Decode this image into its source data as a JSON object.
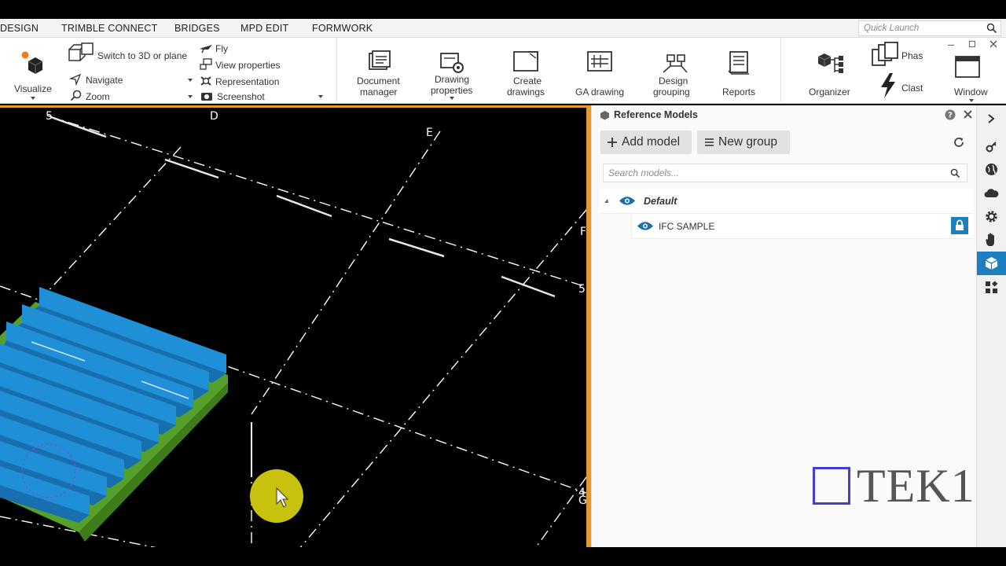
{
  "menu": {
    "tabs": [
      "DESIGN",
      "TRIMBLE CONNECT",
      "BRIDGES",
      "MPD EDIT",
      "FORMWORK"
    ],
    "quick_launch_placeholder": "Quick Launch"
  },
  "ribbon": {
    "visualize_label": "Visualize",
    "switch_3d_label": "Switch to 3D or plane",
    "navigate_label": "Navigate",
    "zoom_label": "Zoom",
    "fly_label": "Fly",
    "view_properties_label": "View properties",
    "representation_label": "Representation",
    "screenshot_label": "Screenshot",
    "document_manager_label": [
      "Document",
      "manager"
    ],
    "drawing_properties_label": [
      "Drawing",
      "properties"
    ],
    "create_drawings_label": [
      "Create",
      "drawings"
    ],
    "ga_drawing_label": "GA drawing",
    "design_grouping_label": [
      "Design",
      "grouping"
    ],
    "reports_label": "Reports",
    "organizer_label": "Organizer",
    "phase_label": "Phas",
    "clash_label": "Clast",
    "window_label": "Window"
  },
  "viewport": {
    "grid_labels": [
      "5",
      "D",
      "E",
      "F",
      "5",
      "4",
      "G"
    ]
  },
  "reference_panel": {
    "title": "Reference Models",
    "add_model_label": "Add model",
    "new_group_label": "New group",
    "search_placeholder": "Search models...",
    "group_name": "Default",
    "model_name": "IFC SAMPLE"
  },
  "side_strip": {
    "icons": [
      "chevron-right-icon",
      "key-settings-icon",
      "globe-icon",
      "cloud-icon",
      "gear-icon",
      "hand-icon",
      "cube-icon",
      "layout-icon"
    ],
    "active_index": 6
  },
  "watermark": {
    "text": "TEK1"
  },
  "colors": {
    "accent_blue": "#1d7fc0",
    "viewport_border": "#e8972d",
    "beam_blue": "#1f8fd8",
    "beam_green": "#5aa02a",
    "cursor_highlight": "#c8c20e"
  }
}
